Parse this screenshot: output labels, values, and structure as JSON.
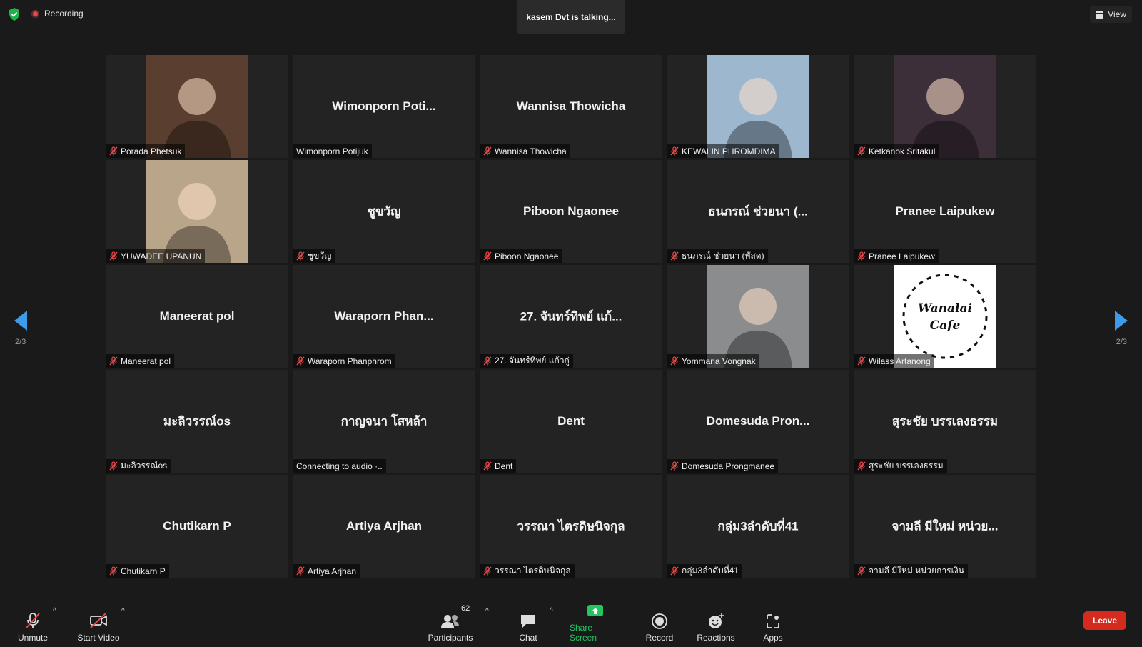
{
  "top": {
    "recording_label": "Recording",
    "talking_text": "kasem Dvt is talking...",
    "view_label": "View"
  },
  "pagination": {
    "left": "2/3",
    "right": "2/3"
  },
  "participants": [
    {
      "display": "",
      "label": "Porada Phetsuk",
      "video": true,
      "photo_color": "#5a3e2f"
    },
    {
      "display": "Wimonporn  Poti...",
      "label": "Wimonporn Potijuk",
      "video": false,
      "mic_off_icon": false
    },
    {
      "display": "Wannisa Thowicha",
      "label": "Wannisa Thowicha",
      "video": false
    },
    {
      "display": "",
      "label": "KEWALIN PHROMDIMA",
      "video": true,
      "photo_color": "#9db7cf"
    },
    {
      "display": "",
      "label": "Ketkanok Sritakul",
      "video": true,
      "photo_color": "#3c2f3a"
    },
    {
      "display": "",
      "label": "YUWADEE UPANUN",
      "video": true,
      "photo_color": "#b9a58a"
    },
    {
      "display": "ชูขวัญ",
      "label": "ชูขวัญ",
      "video": false
    },
    {
      "display": "Piboon Ngaonee",
      "label": "Piboon Ngaonee",
      "video": false
    },
    {
      "display": "ธนภรณ์ ช่วยนา (...",
      "label": "ธนภรณ์ ช่วยนา (พัสด)",
      "video": false
    },
    {
      "display": "Pranee Laipukew",
      "label": "Pranee Laipukew",
      "video": false
    },
    {
      "display": "Maneerat pol",
      "label": "Maneerat pol",
      "video": false
    },
    {
      "display": "Waraporn  Phan...",
      "label": "Waraporn Phanphrom",
      "video": false
    },
    {
      "display": "27. จันทร์ทิพย์ แก้...",
      "label": "27. จันทร์ทิพย์ แก้วกู่",
      "video": false
    },
    {
      "display": "",
      "label": "Yommana Vongnak",
      "video": true,
      "photo_color": "#8a8c8e"
    },
    {
      "display": "",
      "label": "Wilass Artanong",
      "video": true,
      "photo_color": "#ffffff",
      "logo_text": "Wanalai Cafe"
    },
    {
      "display": "มะลิวรรณ์os",
      "label": "มะลิวรรณ์os",
      "video": false
    },
    {
      "display": "กาญจนา  โสหล้า",
      "label": "Connecting to audio ·..",
      "video": false,
      "mic_off_icon": false
    },
    {
      "display": "Dent",
      "label": "Dent",
      "video": false
    },
    {
      "display": "Domesuda  Pron...",
      "label": "Domesuda Prongmanee",
      "video": false
    },
    {
      "display": "สุระชัย บรรเลงธรรม",
      "label": "สุระชัย บรรเลงธรรม",
      "video": false
    },
    {
      "display": "Chutikarn P",
      "label": "Chutikarn P",
      "video": false
    },
    {
      "display": "Artiya Arjhan",
      "label": "Artiya Arjhan",
      "video": false
    },
    {
      "display": "วรรณา ไตรดิษนิจกุล",
      "label": "วรรณา ไตรดิษนิจกุล",
      "video": false
    },
    {
      "display": "กลุ่ม3ลำดับที่41",
      "label": "กลุ่ม3ลำดับที่41",
      "video": false
    },
    {
      "display": "จามลี มีใหม่ หน่วย...",
      "label": "จามลี มีใหม่ หน่วยการเงิน",
      "video": false
    }
  ],
  "toolbar": {
    "unmute": "Unmute",
    "start_video": "Start Video",
    "participants": "Participants",
    "participants_count": "62",
    "chat": "Chat",
    "share_screen": "Share Screen",
    "record": "Record",
    "reactions": "Reactions",
    "apps": "Apps",
    "leave": "Leave"
  },
  "colors": {
    "accent_blue": "#3d9be9",
    "share_green": "#22c55e",
    "leave_red": "#d52b1e",
    "mic_off_red": "#e04a4a"
  }
}
